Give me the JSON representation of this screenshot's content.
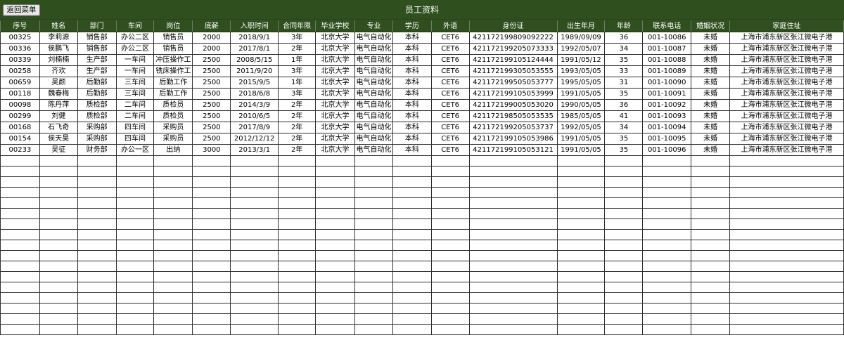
{
  "window": {
    "title": "员工资料",
    "back_button": "返回菜单"
  },
  "colors": {
    "header_bg": "#2f4f1f",
    "header_text": "#ffffff",
    "grid_line": "#2e2e2e"
  },
  "table": {
    "headers": [
      "序号",
      "姓名",
      "部门",
      "车间",
      "岗位",
      "底薪",
      "入职时间",
      "合同年限",
      "毕业学校",
      "专业",
      "学历",
      "外语",
      "身份证",
      "出生年月",
      "年龄",
      "联系电话",
      "婚姻状况",
      "家庭住址"
    ],
    "rows": [
      [
        "00325",
        "李莉源",
        "销售部",
        "办公二区",
        "销售员",
        "2000",
        "2018/9/1",
        "3年",
        "北京大学",
        "电气自动化",
        "本科",
        "CET6",
        "421172199809092222",
        "1989/09/09",
        "36",
        "001-10086",
        "未婚",
        "上海市浦东新区张江微电子港"
      ],
      [
        "00336",
        "侯鹏飞",
        "销售部",
        "办公二区",
        "销售员",
        "2000",
        "2017/8/1",
        "2年",
        "北京大学",
        "电气自动化",
        "本科",
        "CET6",
        "421172199205073333",
        "1992/05/07",
        "34",
        "001-10087",
        "未婚",
        "上海市浦东新区张江微电子港"
      ],
      [
        "00339",
        "刘楠楠",
        "生产部",
        "一车间",
        "冲压操作工",
        "2500",
        "2008/5/15",
        "1年",
        "北京大学",
        "电气自动化",
        "本科",
        "CET6",
        "421172199105124444",
        "1991/05/12",
        "35",
        "001-10088",
        "未婚",
        "上海市浦东新区张江微电子港"
      ],
      [
        "00258",
        "齐欢",
        "生产部",
        "一车间",
        "铣床操作工",
        "2500",
        "2011/9/20",
        "3年",
        "北京大学",
        "电气自动化",
        "本科",
        "CET6",
        "421172199305053555",
        "1993/05/05",
        "33",
        "001-10089",
        "未婚",
        "上海市浦东新区张江微电子港"
      ],
      [
        "00659",
        "吴颜",
        "后勤部",
        "三车间",
        "后勤工作",
        "2500",
        "2015/9/5",
        "1年",
        "北京大学",
        "电气自动化",
        "本科",
        "CET6",
        "421172199505053777",
        "1995/05/05",
        "31",
        "001-10090",
        "未婚",
        "上海市浦东新区张江微电子港"
      ],
      [
        "00118",
        "魏春梅",
        "后勤部",
        "三车间",
        "后勤工作",
        "2500",
        "2018/6/8",
        "3年",
        "北京大学",
        "电气自动化",
        "本科",
        "CET6",
        "421172199105053999",
        "1991/05/05",
        "35",
        "001-10091",
        "未婚",
        "上海市浦东新区张江微电子港"
      ],
      [
        "00098",
        "陈丹萍",
        "质检部",
        "二车间",
        "质检员",
        "2500",
        "2014/3/9",
        "2年",
        "北京大学",
        "电气自动化",
        "本科",
        "CET6",
        "421172199005053020",
        "1990/05/05",
        "36",
        "001-10092",
        "未婚",
        "上海市浦东新区张江微电子港"
      ],
      [
        "00299",
        "刘健",
        "质检部",
        "二车间",
        "质检员",
        "2500",
        "2010/6/5",
        "2年",
        "北京大学",
        "电气自动化",
        "本科",
        "CET6",
        "421172198505053535",
        "1985/05/05",
        "41",
        "001-10093",
        "未婚",
        "上海市浦东新区张江微电子港"
      ],
      [
        "00168",
        "石飞奇",
        "采购部",
        "四车间",
        "采购员",
        "2500",
        "2017/8/9",
        "2年",
        "北京大学",
        "电气自动化",
        "本科",
        "CET6",
        "421172199205053737",
        "1992/05/05",
        "34",
        "001-10094",
        "未婚",
        "上海市浦东新区张江微电子港"
      ],
      [
        "00154",
        "侯天昊",
        "采购部",
        "四车间",
        "采购员",
        "2500",
        "2012/12/12",
        "2年",
        "北京大学",
        "电气自动化",
        "本科",
        "CET6",
        "421172199105053986",
        "1991/05/05",
        "35",
        "001-10095",
        "未婚",
        "上海市浦东新区张江微电子港"
      ],
      [
        "00233",
        "吴征",
        "财务部",
        "办公一区",
        "出纳",
        "3000",
        "2013/3/1",
        "2年",
        "北京大学",
        "电气自动化",
        "本科",
        "CET6",
        "421172199105053121",
        "1991/05/05",
        "35",
        "001-10096",
        "未婚",
        "上海市浦东新区张江微电子港"
      ]
    ]
  }
}
